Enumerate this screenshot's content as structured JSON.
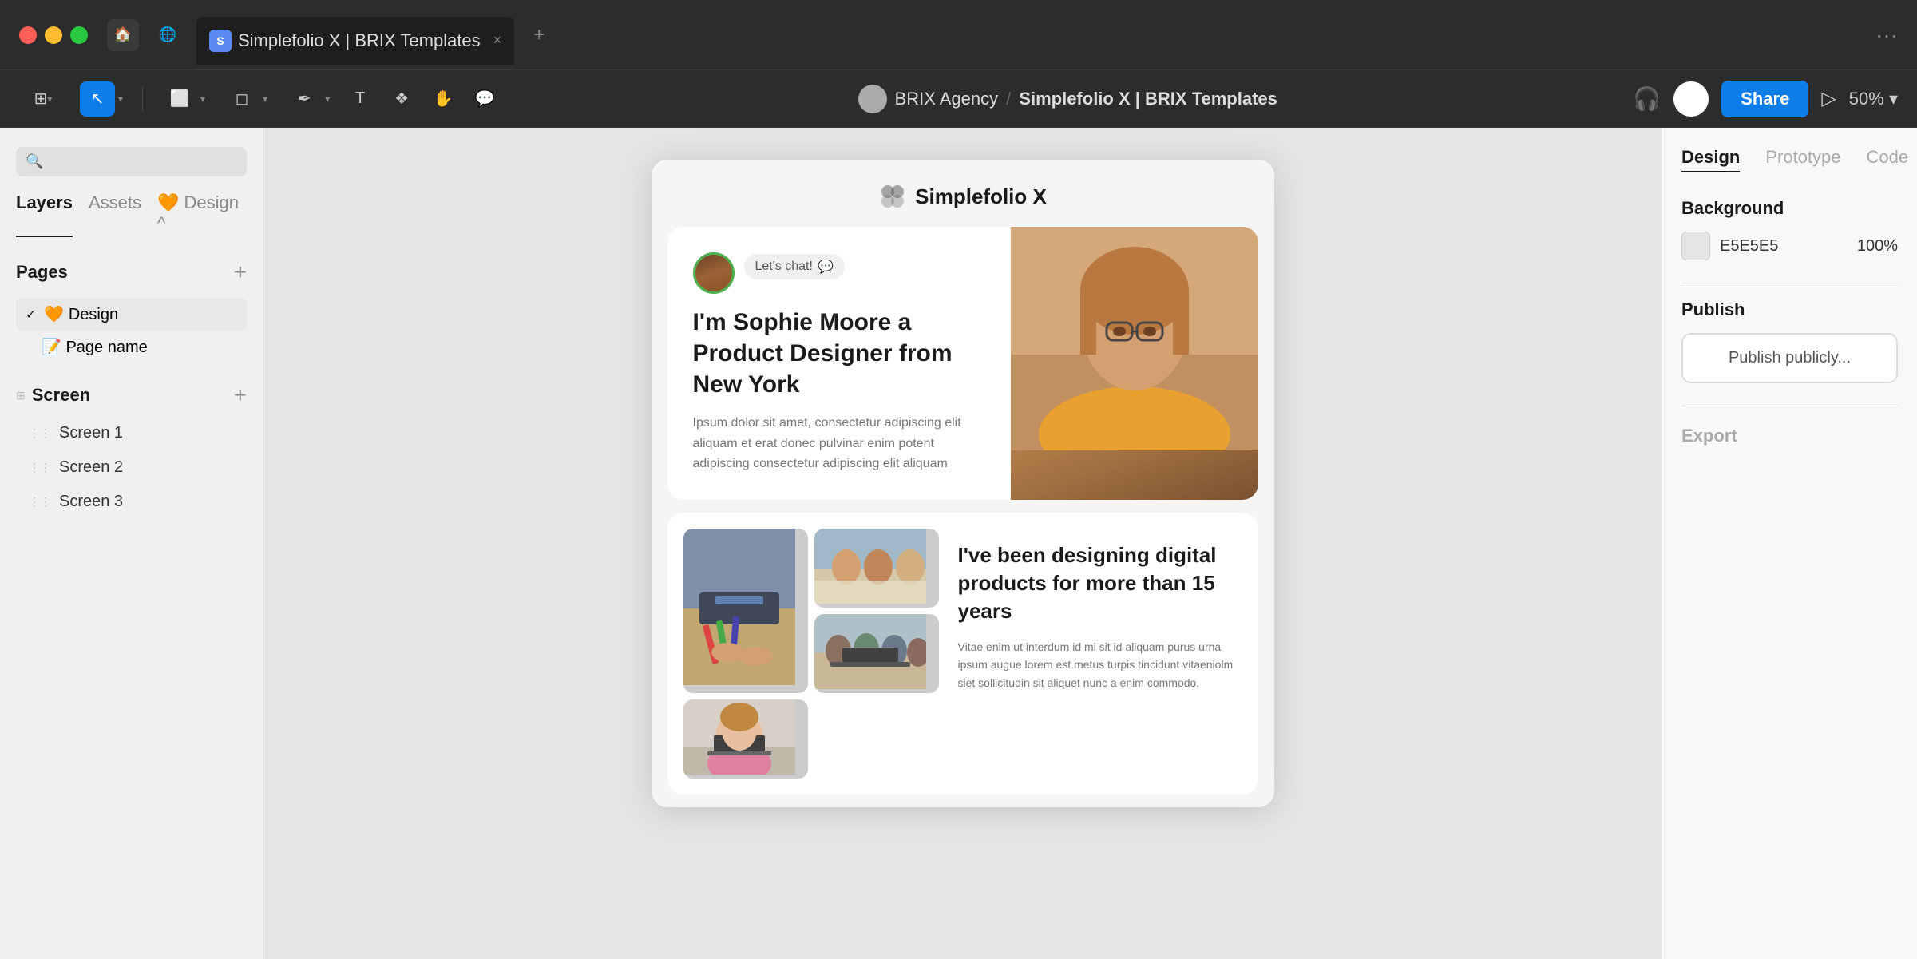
{
  "titlebar": {
    "tab_label": "Simplefolio X | BRIX Templates",
    "tab_close": "×",
    "new_tab": "+",
    "more_options": "···"
  },
  "toolbar": {
    "breadcrumb_org": "BRIX Agency",
    "breadcrumb_sep": "/",
    "breadcrumb_file": "Simplefolio X | BRIX Templates",
    "share_label": "Share",
    "zoom_label": "50%"
  },
  "sidebar": {
    "search_placeholder": "Search",
    "tab_layers": "Layers",
    "tab_assets": "Assets",
    "tab_design": "Design",
    "pages_title": "Pages",
    "pages_add": "+",
    "page_design_label": "🧡 Design",
    "page_name_label": "📝 Page name",
    "screen_title": "Screen",
    "screen_add": "+",
    "screens": [
      {
        "label": "Screen 1"
      },
      {
        "label": "Screen 2"
      },
      {
        "label": "Screen 3"
      }
    ]
  },
  "canvas": {
    "logo_text": "Simplefolio X",
    "hero": {
      "chat_label": "Let's chat!",
      "title": "I'm Sophie Moore a Product Designer from New York",
      "body": "Ipsum dolor sit amet, consectetur adipiscing elit aliquam et erat donec pulvinar enim potent adipiscing consectetur adipiscing elit aliquam"
    },
    "second": {
      "title": "I've been designing digital products for more than 15 years",
      "body": "Vitae enim ut interdum id mi sit id aliquam purus urna ipsum augue lorem est metus turpis tincidunt vitaeniolm siet sollicitudin sit aliquet nunc a enim commodo."
    }
  },
  "right_panel": {
    "tab_design": "Design",
    "tab_prototype": "Prototype",
    "tab_code": "Code",
    "background_label": "Background",
    "bg_hex": "E5E5E5",
    "bg_opacity": "100%",
    "publish_label": "Publish",
    "publish_btn": "Publish publicly...",
    "export_label": "Export"
  }
}
